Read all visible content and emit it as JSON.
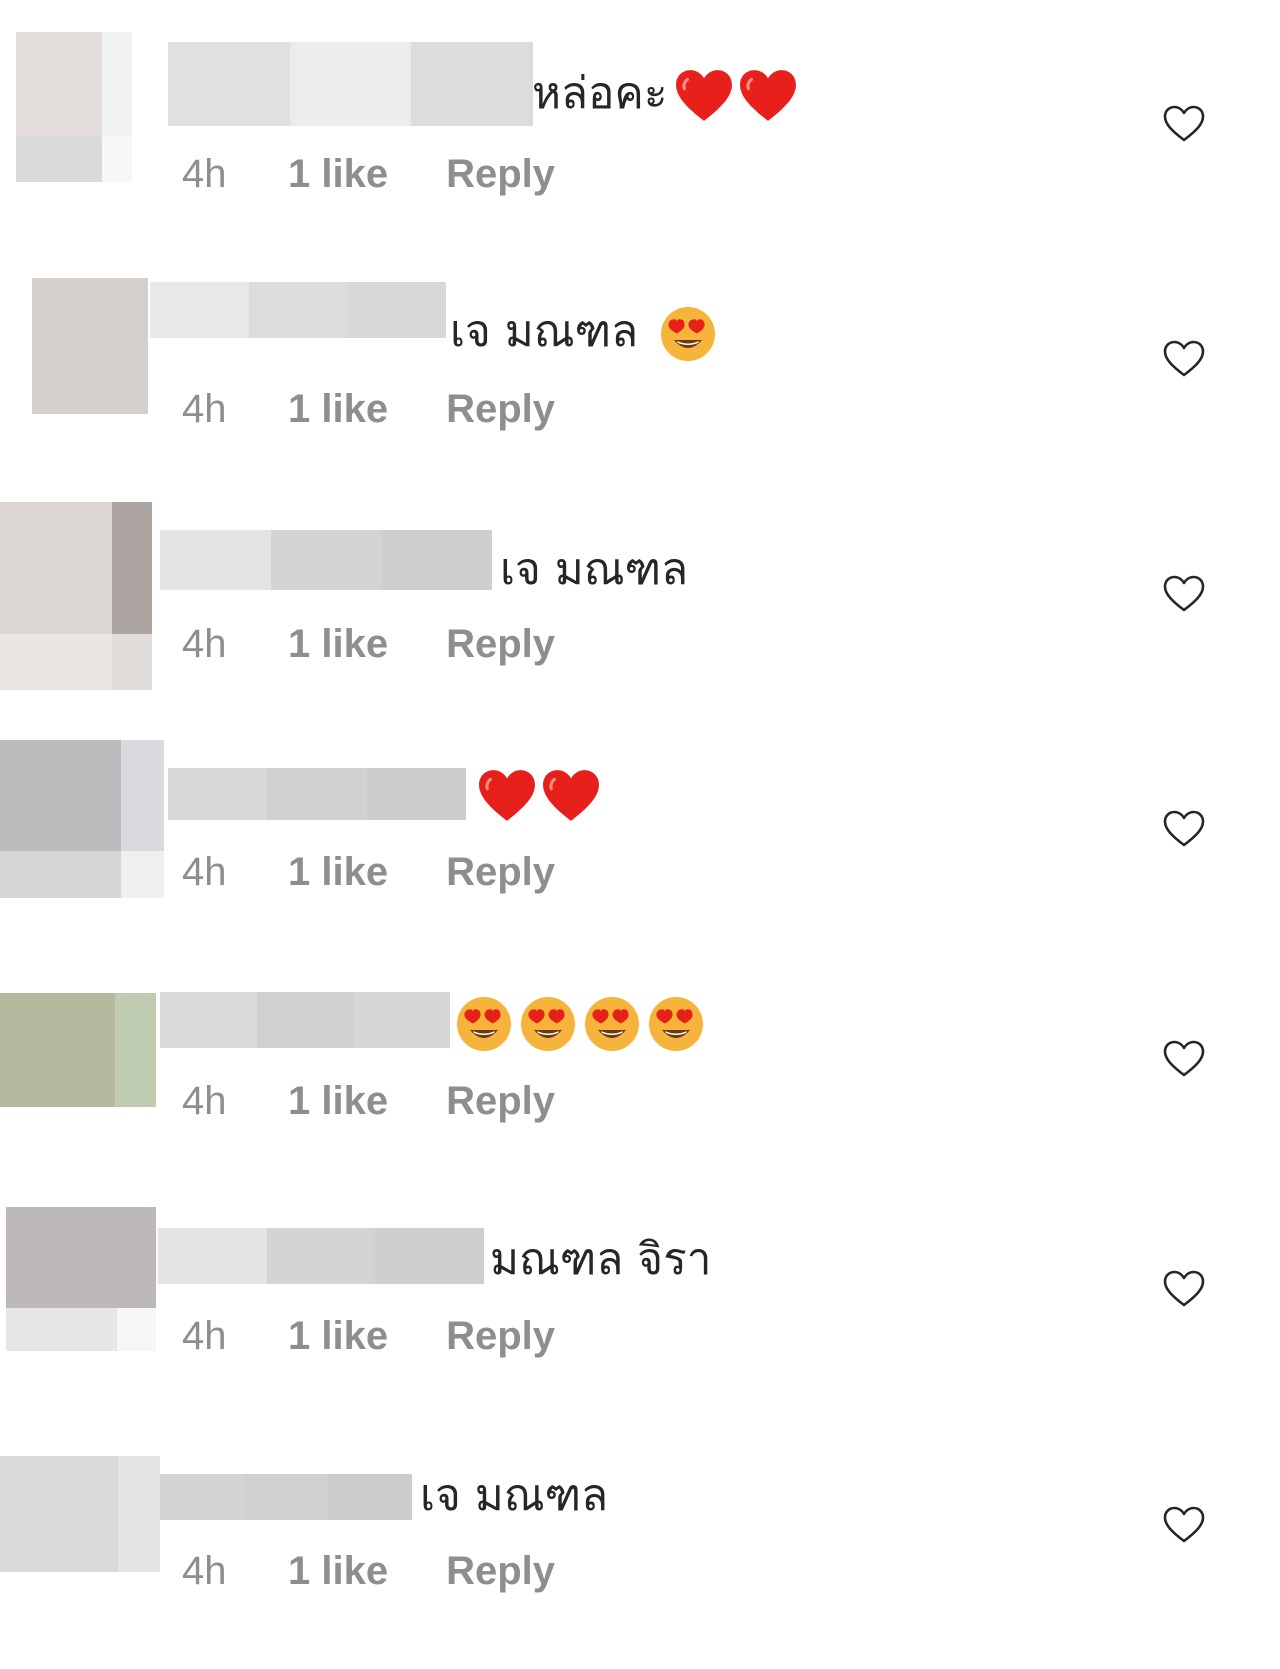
{
  "comments": [
    {
      "text": "หล่อคะ",
      "emojis": [
        "red-heart-emoji",
        "red-heart-emoji"
      ],
      "time": "4h",
      "likes": "1 like",
      "reply": "Reply",
      "avatar_colors": [
        "#e2dcda",
        "#f2f2f2",
        "#d9d9d9",
        "#f7f7f7"
      ],
      "blur_colors": [
        "#e0e0e0",
        "#ececec",
        "#dcdcdc"
      ]
    },
    {
      "text": "เจ มณฑล",
      "emojis": [
        "heart-eyes-emoji"
      ],
      "time": "4h",
      "likes": "1 like",
      "reply": "Reply",
      "avatar_colors": [
        "#d2cfcd",
        "#d2cfcd",
        "#d2cfcd",
        "#d2cfcd"
      ],
      "blur_colors": [
        "#e8e8e8",
        "#dcdcdc",
        "#d8d8d8"
      ]
    },
    {
      "text": "เจ มณฑล",
      "emojis": [],
      "time": "4h",
      "likes": "1 like",
      "reply": "Reply",
      "avatar_colors": [
        "#dcd6d3",
        "#aba4a1",
        "#e8e5e3",
        "#dfdcda"
      ],
      "blur_colors": [
        "#e4e4e4",
        "#d4d4d4",
        "#cfcfcf"
      ]
    },
    {
      "text": "",
      "emojis": [
        "red-heart-emoji",
        "red-heart-emoji"
      ],
      "time": "4h",
      "likes": "1 like",
      "reply": "Reply",
      "avatar_colors": [
        "#bcbcbf",
        "#d8dadd",
        "#d6d6d9",
        "#efeff1"
      ],
      "blur_colors": [
        "#d8d8d8",
        "#d0d0d0",
        "#cccccc"
      ]
    },
    {
      "text": "",
      "emojis": [
        "heart-eyes-emoji",
        "heart-eyes-emoji",
        "heart-eyes-emoji",
        "heart-eyes-emoji"
      ],
      "time": "4h",
      "likes": "1 like",
      "reply": "Reply",
      "avatar_colors": [
        "#b6b99e",
        "#bfccb1",
        "#b6b99e",
        "#bfccb1"
      ],
      "blur_colors": [
        "#dadada",
        "#d0d0d0",
        "#d6d6d6"
      ]
    },
    {
      "text": "มณฑล จิรา",
      "emojis": [],
      "time": "4h",
      "likes": "1 like",
      "reply": "Reply",
      "avatar_colors": [
        "#bdb9b9",
        "#bdb9b9",
        "#e6e6e8",
        "#f6f6f6"
      ],
      "blur_colors": [
        "#e4e4e4",
        "#d4d4d4",
        "#cfcfcf"
      ]
    },
    {
      "text": "เจ มณฑล",
      "emojis": [],
      "time": "4h",
      "likes": "1 like",
      "reply": "Reply",
      "avatar_colors": [
        "#d9d9d9",
        "#e3e3e3",
        "#d9d9d9",
        "#e3e3e3"
      ],
      "blur_colors": [
        "#d4d4d4",
        "#d0d0d0",
        "#cccccc"
      ]
    }
  ],
  "like_icon": "heart-outline-icon",
  "colors": {
    "meta_text": "#8e8e8e",
    "heart_red": "#e8201c",
    "emoji_face": "#f6b53a"
  }
}
